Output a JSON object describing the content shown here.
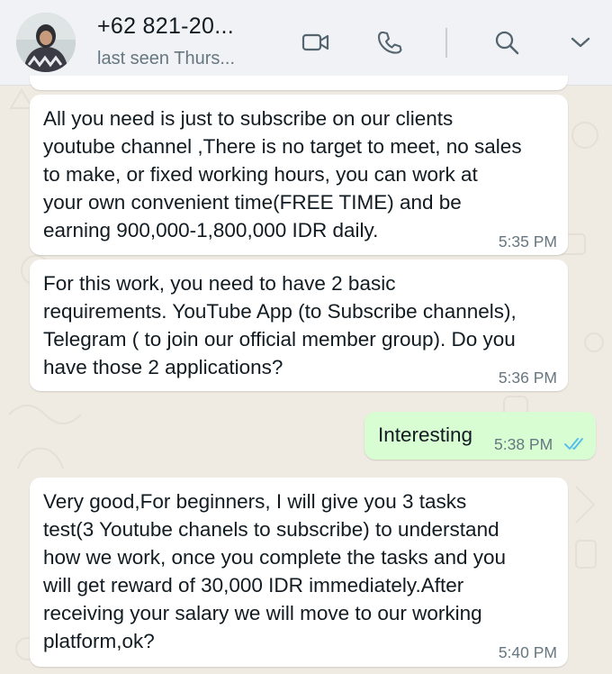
{
  "header": {
    "contact_name": "+62 821-20...",
    "contact_status": "last seen Thurs...",
    "icons": [
      "video-call-icon",
      "phone-icon",
      "search-icon",
      "chevron-down-icon"
    ]
  },
  "messages": [
    {
      "direction": "incoming",
      "text": "All you need is just to subscribe on our clients\nyoutube channel ,There is no target to meet, no sales\nto make, or fixed working hours, you can work at\nyour own convenient time(FREE TIME) and be\nearning 900,000-1,800,000 IDR daily.",
      "time": "5:35 PM"
    },
    {
      "direction": "incoming",
      "text": "For this work, you need to have 2 basic\nrequirements. YouTube App (to Subscribe channels),\nTelegram ( to join our official member group). Do you\nhave those 2 applications?",
      "time": "5:36 PM"
    },
    {
      "direction": "outgoing",
      "text": "Interesting",
      "time": "5:38 PM",
      "status": "read"
    },
    {
      "direction": "incoming",
      "text": "Very good,For beginners, I will give you 3 tasks\ntest(3 Youtube chanels to subscribe) to understand\nhow we work, once you complete the tasks and you\nwill get reward of 30,000 IDR immediately.After\nreceiving your salary we will move to our working\nplatform,ok?",
      "time": "5:40 PM"
    }
  ],
  "colors": {
    "header_bg": "#f0f2f5",
    "chat_bg": "#efeae2",
    "incoming_bubble": "#ffffff",
    "outgoing_bubble": "#d9fdd3",
    "read_ticks": "#53bdeb",
    "icon_gray": "#54656f"
  }
}
